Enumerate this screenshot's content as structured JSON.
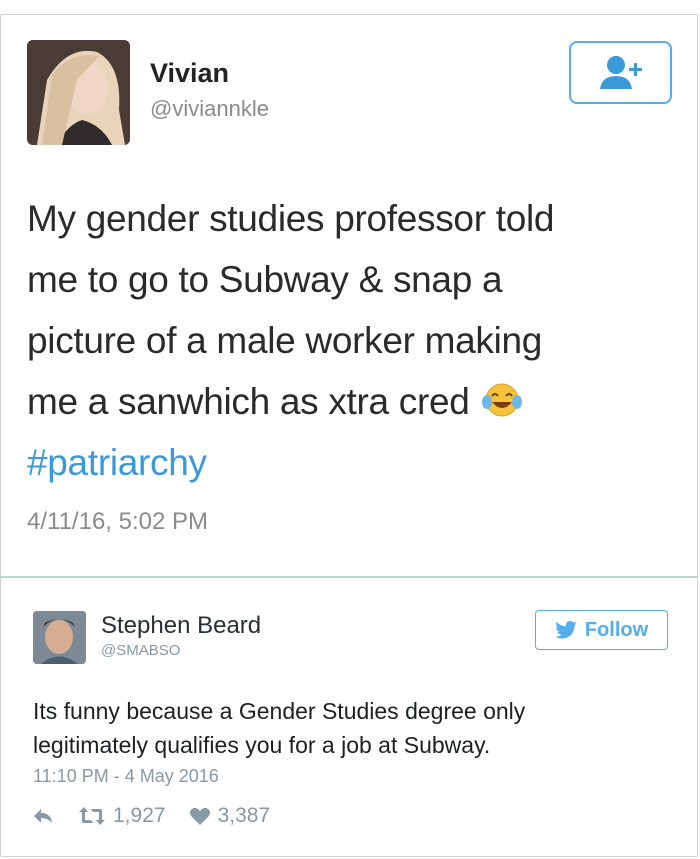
{
  "tweet1": {
    "name": "Vivian",
    "handle": "@viviannkle",
    "text_lines": [
      "My gender studies professor told",
      "me to go to Subway & snap a",
      "picture of a male worker making",
      "me a sanwhich as xtra cred"
    ],
    "hashtag": "#patriarchy",
    "emoji": "face-with-tears-of-joy",
    "date": "4/11/16, 5:02 PM",
    "follow_icon": "add-user-icon"
  },
  "tweet2": {
    "name": "Stephen Beard",
    "handle": "@SMABSO",
    "follow_label": "Follow",
    "text_lines": [
      "Its funny because a Gender Studies degree only",
      "legitimately qualifies you for a job at Subway."
    ],
    "timestamp": "11:10 PM - 4 May 2016",
    "retweets": "1,927",
    "likes": "3,387"
  },
  "colors": {
    "twitter_blue": "#55acee",
    "hashtag": "#3a9ad9",
    "muted": "#8899a6",
    "divider": "#b8dcc9"
  }
}
